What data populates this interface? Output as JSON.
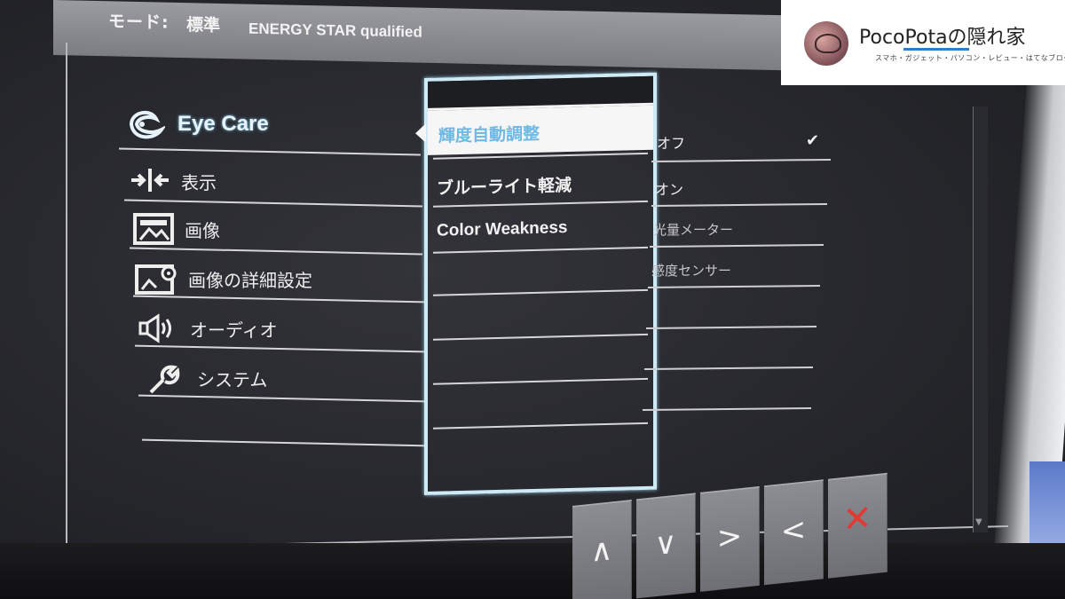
{
  "header": {
    "mode_label": "モード:",
    "mode_value": "標準",
    "energy_label": "ENERGY STAR qualified"
  },
  "menu": {
    "items": [
      {
        "label": "Eye Care",
        "icon": "eye-care-icon"
      },
      {
        "label": "表示",
        "icon": "display-arrows-icon"
      },
      {
        "label": "画像",
        "icon": "picture-icon"
      },
      {
        "label": "画像の詳細設定",
        "icon": "picture-settings-icon"
      },
      {
        "label": "オーディオ",
        "icon": "speaker-icon"
      },
      {
        "label": "システム",
        "icon": "wrench-icon"
      }
    ]
  },
  "submenu": {
    "selected": "輝度自動調整",
    "items": [
      {
        "label": "ブルーライト軽減"
      },
      {
        "label": "Color Weakness"
      }
    ]
  },
  "options": {
    "items": [
      {
        "label": "オフ",
        "checked": true
      },
      {
        "label": "オン",
        "checked": false
      },
      {
        "label": "光量メーター",
        "checked": false
      },
      {
        "label": "感度センサー",
        "checked": false
      }
    ],
    "check_glyph": "✔"
  },
  "buttons": [
    {
      "glyph": "∧",
      "icon": "up-icon"
    },
    {
      "glyph": "∨",
      "icon": "down-icon"
    },
    {
      "glyph": ">",
      "icon": "right-icon"
    },
    {
      "glyph": "<",
      "icon": "left-icon"
    },
    {
      "glyph": "✕",
      "icon": "close-icon"
    }
  ],
  "watermark": {
    "title": "PocoPotaの隠れ家",
    "subtitle": "スマホ・ガジェット・パソコン・レビュー・はてなブログ"
  },
  "colors": {
    "accent_blue": "#6fb9e3",
    "close_red": "#e03a35"
  }
}
